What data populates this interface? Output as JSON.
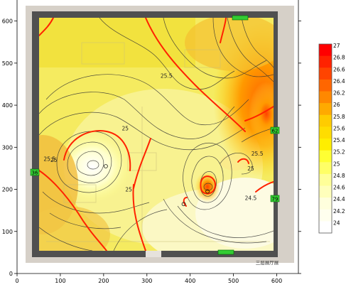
{
  "chart_data": {
    "type": "heatmap",
    "subtype": "temperature contour floor plan",
    "xlim": [
      0,
      650
    ],
    "ylim": [
      0,
      650
    ],
    "xticks": [
      "0",
      "100",
      "200",
      "300",
      "400",
      "500",
      "600"
    ],
    "yticks": [
      "0",
      "100",
      "200",
      "300",
      "400",
      "500",
      "600"
    ],
    "annotation": "三层展厅展",
    "colorbar": {
      "ticks": [
        "27",
        "26.8",
        "26.6",
        "26.4",
        "26.2",
        "26",
        "25.8",
        "25.6",
        "25.4",
        "25.2",
        "25",
        "24.8",
        "24.6",
        "24.4",
        "24.2",
        "24"
      ],
      "colors": [
        "#ff0000",
        "#ff2200",
        "#ff4400",
        "#ff6600",
        "#ff8800",
        "#ffaa00",
        "#ffcc00",
        "#ffdd00",
        "#ffee00",
        "#ffff33",
        "#ffff66",
        "#ffff99",
        "#ffffbb",
        "#ffffdd",
        "#ffffee",
        "#ffffff"
      ]
    },
    "contour_labels": [
      {
        "text": "25.5",
        "x": 345,
        "y": 465
      },
      {
        "text": "25",
        "x": 250,
        "y": 340
      },
      {
        "text": "25",
        "x": 85,
        "y": 265
      },
      {
        "text": "25",
        "x": 258,
        "y": 195
      },
      {
        "text": "25",
        "x": 540,
        "y": 245
      },
      {
        "text": "25.5",
        "x": 75,
        "y": 268
      },
      {
        "text": "25.5",
        "x": 555,
        "y": 280
      },
      {
        "text": "24.5",
        "x": 540,
        "y": 175
      }
    ],
    "hotspots": [
      {
        "x": 440,
        "y": 195
      },
      {
        "x": 205,
        "y": 255
      },
      {
        "x": 385,
        "y": 165
      }
    ],
    "sensors": [
      "36",
      "62",
      "79"
    ]
  }
}
